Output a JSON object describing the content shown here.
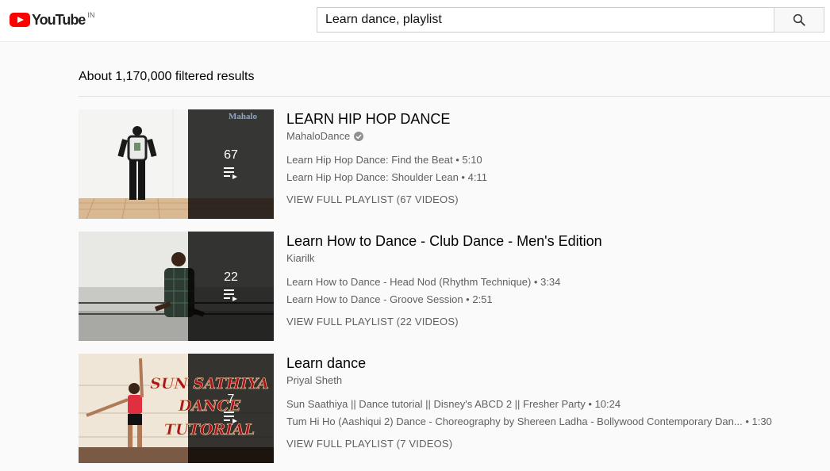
{
  "header": {
    "logo_text": "YouTube",
    "logo_country": "IN",
    "search_value": "Learn dance, playlist",
    "search_icon": "search-icon"
  },
  "results_count": "About 1,170,000 filtered results",
  "results": [
    {
      "title": "LEARN HIP HOP DANCE",
      "channel": "MahaloDance",
      "verified": true,
      "video_count": "67",
      "videos": [
        {
          "title": "Learn Hip Hop Dance: Find the Beat",
          "duration": "5:10"
        },
        {
          "title": "Learn Hip Hop Dance: Shoulder Lean",
          "duration": "4:11"
        }
      ],
      "view_full": "VIEW FULL PLAYLIST (67 VIDEOS)"
    },
    {
      "title": "Learn How to Dance - Club Dance - Men's Edition",
      "channel": "Kiarilk",
      "verified": false,
      "video_count": "22",
      "videos": [
        {
          "title": "Learn How to Dance - Head Nod (Rhythm Technique)",
          "duration": "3:34"
        },
        {
          "title": "Learn How to Dance - Groove Session",
          "duration": "2:51"
        }
      ],
      "view_full": "VIEW FULL PLAYLIST (22 VIDEOS)"
    },
    {
      "title": "Learn dance",
      "channel": "Priyal Sheth",
      "verified": false,
      "video_count": "7",
      "videos": [
        {
          "title": "Sun Saathiya || Dance tutorial || Disney's ABCD 2 || Fresher Party",
          "duration": "10:24"
        },
        {
          "title": "Tum Hi Ho (Aashiqui 2) Dance - Choreography by Shereen Ladha - Bollywood Contemporary Dan...",
          "duration": "1:30"
        }
      ],
      "view_full": "VIEW FULL PLAYLIST (7 VIDEOS)"
    }
  ],
  "thumbnail_texts": {
    "mahalo_watermark": "Mahalo",
    "sun_sathiya_art": "\"SUN SATHIYA\" DANCE TUTORIAL"
  },
  "colors": {
    "brand_red": "#ff0000",
    "text_primary": "#030303",
    "text_secondary": "#606060"
  }
}
